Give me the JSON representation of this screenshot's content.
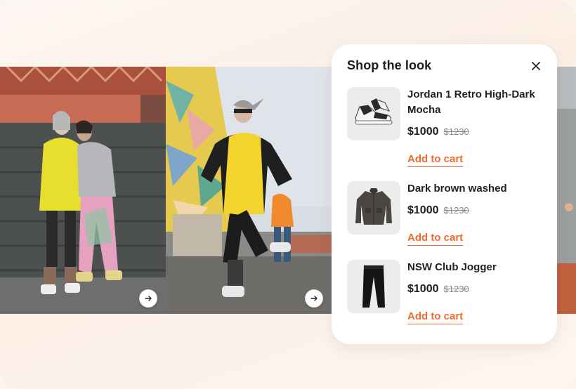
{
  "panel": {
    "title": "Shop the look",
    "close_icon": "close-icon"
  },
  "products": [
    {
      "name": "Jordan 1 Retro High-Dark Mocha",
      "price": "$1000",
      "old_price": "$1230",
      "cta": "Add to cart",
      "thumb_icon": "sneaker-icon"
    },
    {
      "name": "Dark brown washed",
      "price": "$1000",
      "old_price": "$1230",
      "cta": "Add to cart",
      "thumb_icon": "jacket-icon"
    },
    {
      "name": "NSW Club Jogger",
      "price": "$1000",
      "old_price": "$1230",
      "cta": "Add to cart",
      "thumb_icon": "jogger-icon"
    }
  ],
  "carousel": {
    "next_icon": "arrow-right-icon"
  },
  "colors": {
    "accent": "#f06a2c",
    "text": "#1d1d1d",
    "muted": "#8a8a8a"
  }
}
